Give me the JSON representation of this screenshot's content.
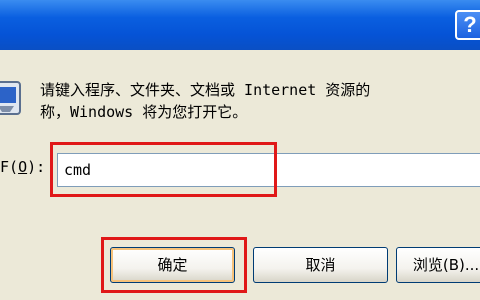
{
  "title_bar": {
    "help_label": "?"
  },
  "dialog": {
    "description_line1": "请键入程序、文件夹、文档或 Internet 资源的",
    "description_line2": "称，Windows 将为您打开它。",
    "open_label_prefix": "(",
    "open_label_hotkey": "O",
    "open_label_suffix": "):",
    "open_label_lead": "F",
    "input_value": "cmd"
  },
  "buttons": {
    "ok": "确定",
    "cancel": "取消",
    "browse": "浏览(B)..."
  },
  "highlight_color": "#e01818"
}
